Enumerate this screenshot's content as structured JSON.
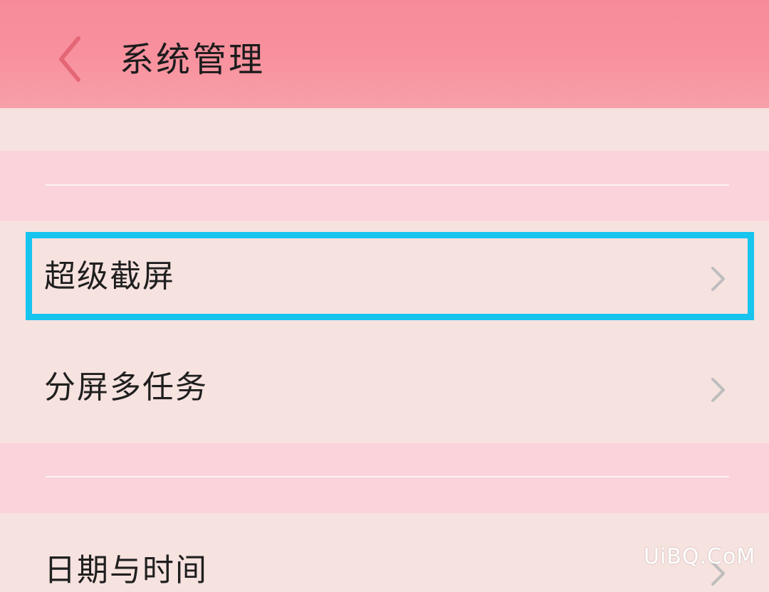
{
  "header": {
    "title": "系统管理",
    "back_icon": "chevron-left-icon",
    "background_color": "#f8909d"
  },
  "list": {
    "partial_item_label": "",
    "items": [
      {
        "label": "超级截屏",
        "icon": "chevron-right-icon",
        "highlighted": true
      },
      {
        "label": "分屏多任务",
        "icon": "chevron-right-icon",
        "highlighted": false
      },
      {
        "label": "日期与时间",
        "icon": "chevron-right-icon",
        "highlighted": false
      }
    ]
  },
  "highlight_color": "#16c4ee",
  "watermark": "UiBQ.CoM"
}
